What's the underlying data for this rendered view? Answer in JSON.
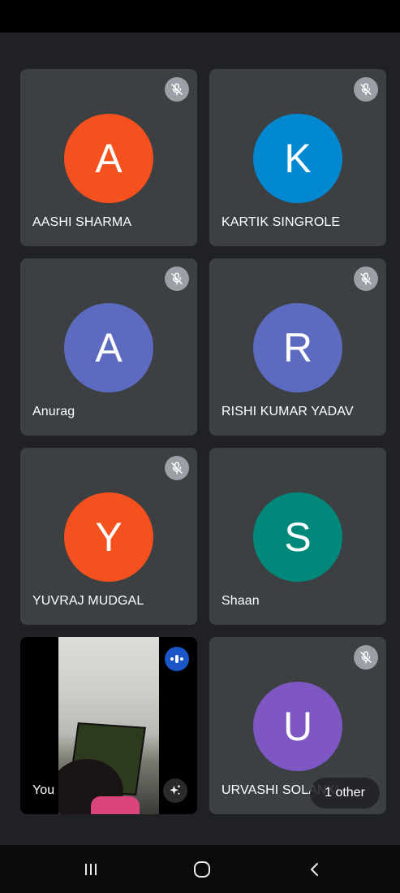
{
  "participants": [
    {
      "initial": "A",
      "name": "AASHI SHARMA",
      "color": "#f4511e",
      "muted": true
    },
    {
      "initial": "K",
      "name": "KARTIK SINGROLE",
      "color": "#0288d1",
      "muted": true
    },
    {
      "initial": "A",
      "name": "Anurag",
      "color": "#5c6bc0",
      "muted": true
    },
    {
      "initial": "R",
      "name": "RISHI KUMAR YADAV",
      "color": "#5c6bc0",
      "muted": true
    },
    {
      "initial": "Y",
      "name": "YUVRAJ MUDGAL",
      "color": "#f4511e",
      "muted": true
    },
    {
      "initial": "S",
      "name": "Shaan",
      "color": "#00897b",
      "muted": false
    },
    {
      "initial": "U",
      "name": "URVASHI SOLANKI",
      "color": "#7e57c2",
      "muted": true
    }
  ],
  "self_tile": {
    "name": "You"
  },
  "others_chip": {
    "label": "1 other"
  },
  "icons": {
    "mute": "mic-off-icon",
    "speaking": "speaking-indicator-icon",
    "effects": "sparkle-effects-icon",
    "nav_recents": "recents-icon",
    "nav_home": "home-icon",
    "nav_back": "back-icon"
  }
}
